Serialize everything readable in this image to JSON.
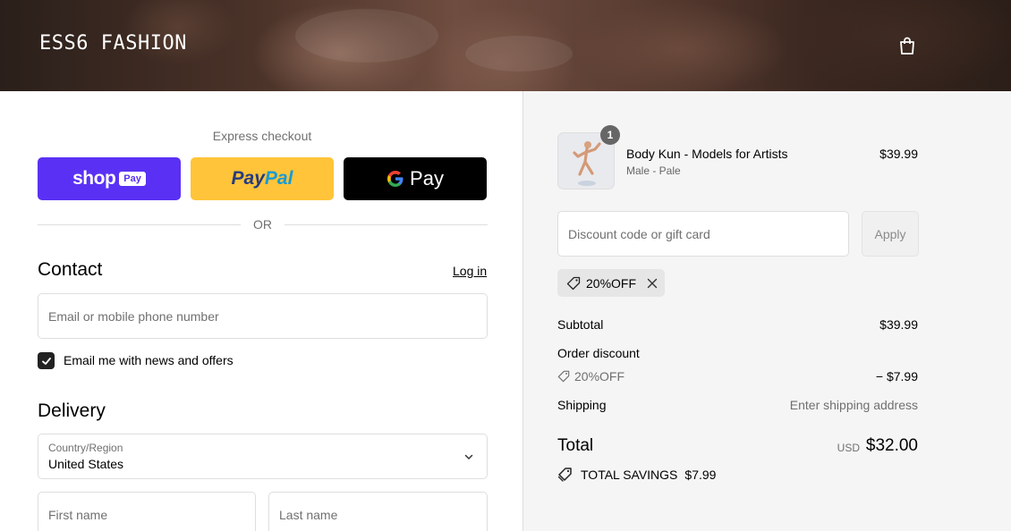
{
  "header": {
    "brand": "ESS6 FASHION"
  },
  "express": {
    "title": "Express checkout",
    "shop_label": "shop",
    "shop_pay_label": "Pay",
    "paypal_part1": "Pay",
    "paypal_part2": "Pal",
    "gpay_label": "Pay",
    "or_label": "OR"
  },
  "contact": {
    "title": "Contact",
    "login_label": "Log in",
    "email_placeholder": "Email or mobile phone number",
    "newsletter_label": "Email me with news and offers",
    "newsletter_checked": true
  },
  "delivery": {
    "title": "Delivery",
    "country_label": "Country/Region",
    "country_value": "United States",
    "first_name_placeholder": "First name",
    "last_name_placeholder": "Last name"
  },
  "order": {
    "product": {
      "name": "Body Kun - Models for Artists",
      "variant": "Male - Pale",
      "price": "$39.99",
      "quantity": "1"
    },
    "discount_placeholder": "Discount code or gift card",
    "apply_label": "Apply",
    "applied_code": "20%OFF",
    "subtotal_label": "Subtotal",
    "subtotal_value": "$39.99",
    "order_discount_label": "Order discount",
    "discount_code_label": "20%OFF",
    "discount_value": "− $7.99",
    "shipping_label": "Shipping",
    "shipping_value": "Enter shipping address",
    "total_label": "Total",
    "total_currency": "USD",
    "total_value": "$32.00",
    "savings_label": "TOTAL SAVINGS",
    "savings_value": "$7.99"
  },
  "colors": {
    "shop_pay": "#5a31f4",
    "paypal": "#ffc439",
    "gpay": "#000000",
    "summary_bg": "#f5f5f5"
  }
}
